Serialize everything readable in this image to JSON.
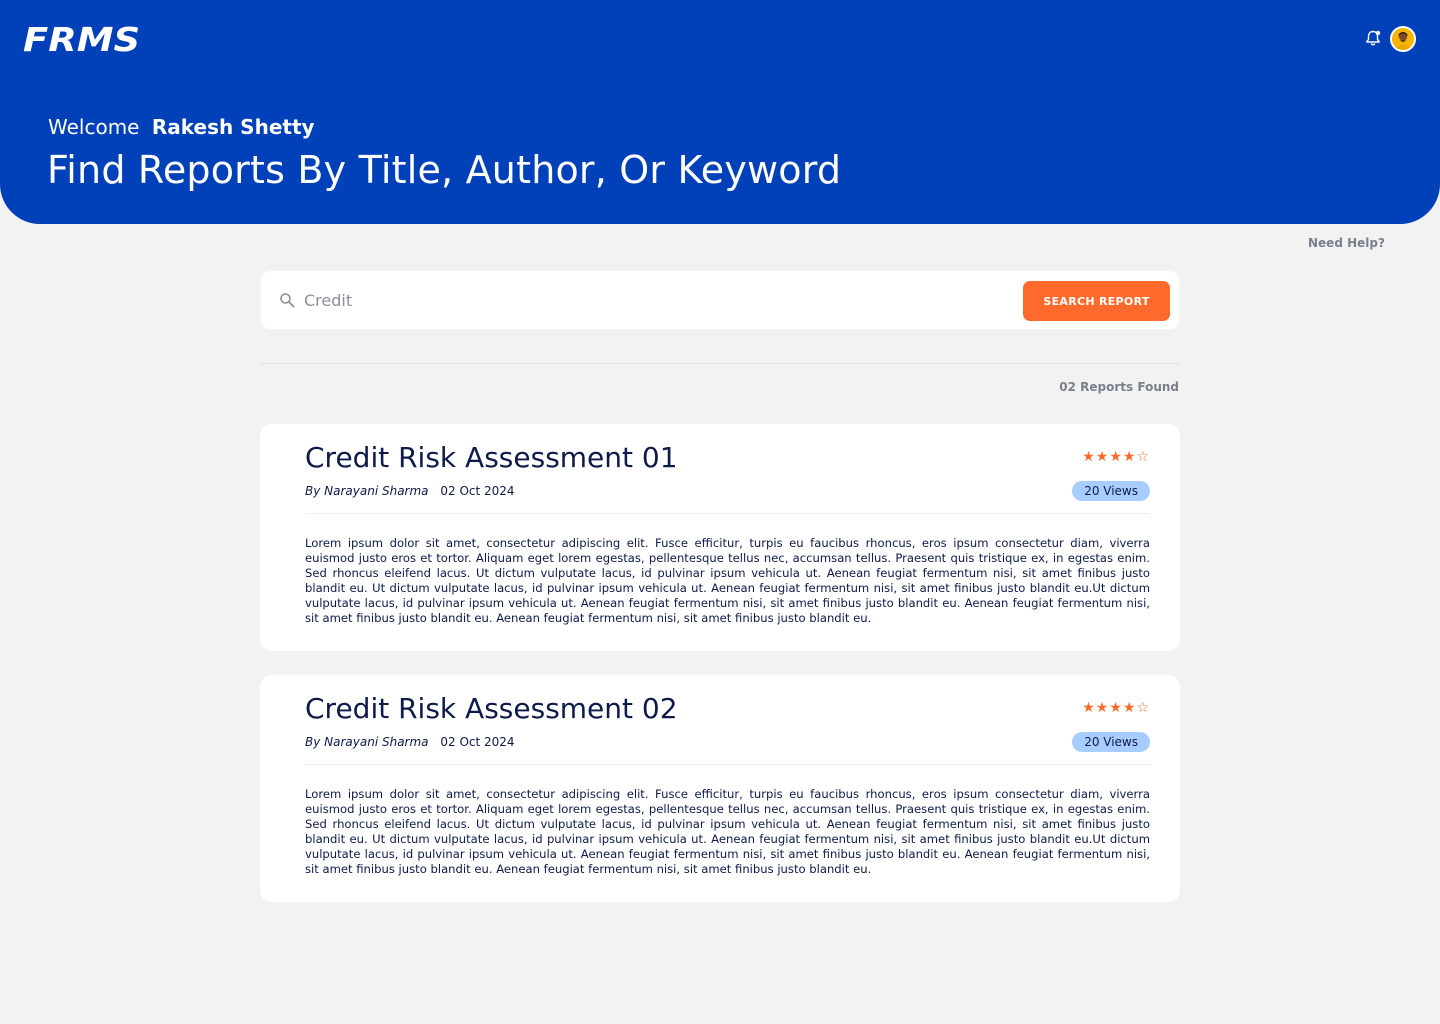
{
  "app": {
    "logo": "FRMS"
  },
  "header": {
    "welcome_label": "Welcome",
    "user_name": "Rakesh Shetty",
    "headline": "Find Reports By Title, Author, Or Keyword",
    "icons": [
      "notification-bell-icon",
      "user-avatar"
    ]
  },
  "help": {
    "label": "Need Help?"
  },
  "search": {
    "value": "Credit",
    "button_label": "SEARCH REPORT"
  },
  "results": {
    "count_label": "02 Reports Found",
    "reports": [
      {
        "title": "Credit Risk Assessment 01",
        "author": "By Narayani Sharma",
        "date": "02 Oct 2024",
        "rating": 4,
        "rating_max": 5,
        "views": "20 Views",
        "summary": "Lorem ipsum dolor sit amet, consectetur adipiscing elit. Fusce efficitur, turpis eu faucibus rhoncus, eros ipsum consectetur diam, viverra euismod justo eros et tortor. Aliquam eget lorem egestas, pellentesque tellus nec, accumsan tellus. Praesent quis tristique ex, in egestas enim. Sed rhoncus eleifend lacus. Ut dictum vulputate lacus, id pulvinar ipsum vehicula ut. Aenean feugiat fermentum nisi, sit amet finibus justo blandit eu. Ut dictum vulputate lacus, id pulvinar ipsum vehicula ut. Aenean feugiat fermentum nisi, sit amet finibus justo blandit eu.Ut dictum vulputate lacus, id pulvinar ipsum vehicula ut. Aenean feugiat fermentum nisi, sit amet finibus justo blandit eu. Aenean feugiat fermentum nisi, sit amet finibus justo blandit eu. Aenean feugiat fermentum nisi, sit amet finibus justo blandit eu."
      },
      {
        "title": "Credit Risk Assessment 02",
        "author": "By Narayani Sharma",
        "date": "02 Oct 2024",
        "rating": 4,
        "rating_max": 5,
        "views": "20 Views",
        "summary": "Lorem ipsum dolor sit amet, consectetur adipiscing elit. Fusce efficitur, turpis eu faucibus rhoncus, eros ipsum consectetur diam, viverra euismod justo eros et tortor. Aliquam eget lorem egestas, pellentesque tellus nec, accumsan tellus. Praesent quis tristique ex, in egestas enim. Sed rhoncus eleifend lacus. Ut dictum vulputate lacus, id pulvinar ipsum vehicula ut. Aenean feugiat fermentum nisi, sit amet finibus justo blandit eu. Ut dictum vulputate lacus, id pulvinar ipsum vehicula ut. Aenean feugiat fermentum nisi, sit amet finibus justo blandit eu.Ut dictum vulputate lacus, id pulvinar ipsum vehicula ut. Aenean feugiat fermentum nisi, sit amet finibus justo blandit eu. Aenean feugiat fermentum nisi, sit amet finibus justo blandit eu. Aenean feugiat fermentum nisi, sit amet finibus justo blandit eu."
      }
    ]
  },
  "colors": {
    "header_bg": "#0040b8",
    "accent": "#ff6a2c",
    "views_badge": "#a7cdff",
    "page_bg": "#f2f2f2"
  }
}
